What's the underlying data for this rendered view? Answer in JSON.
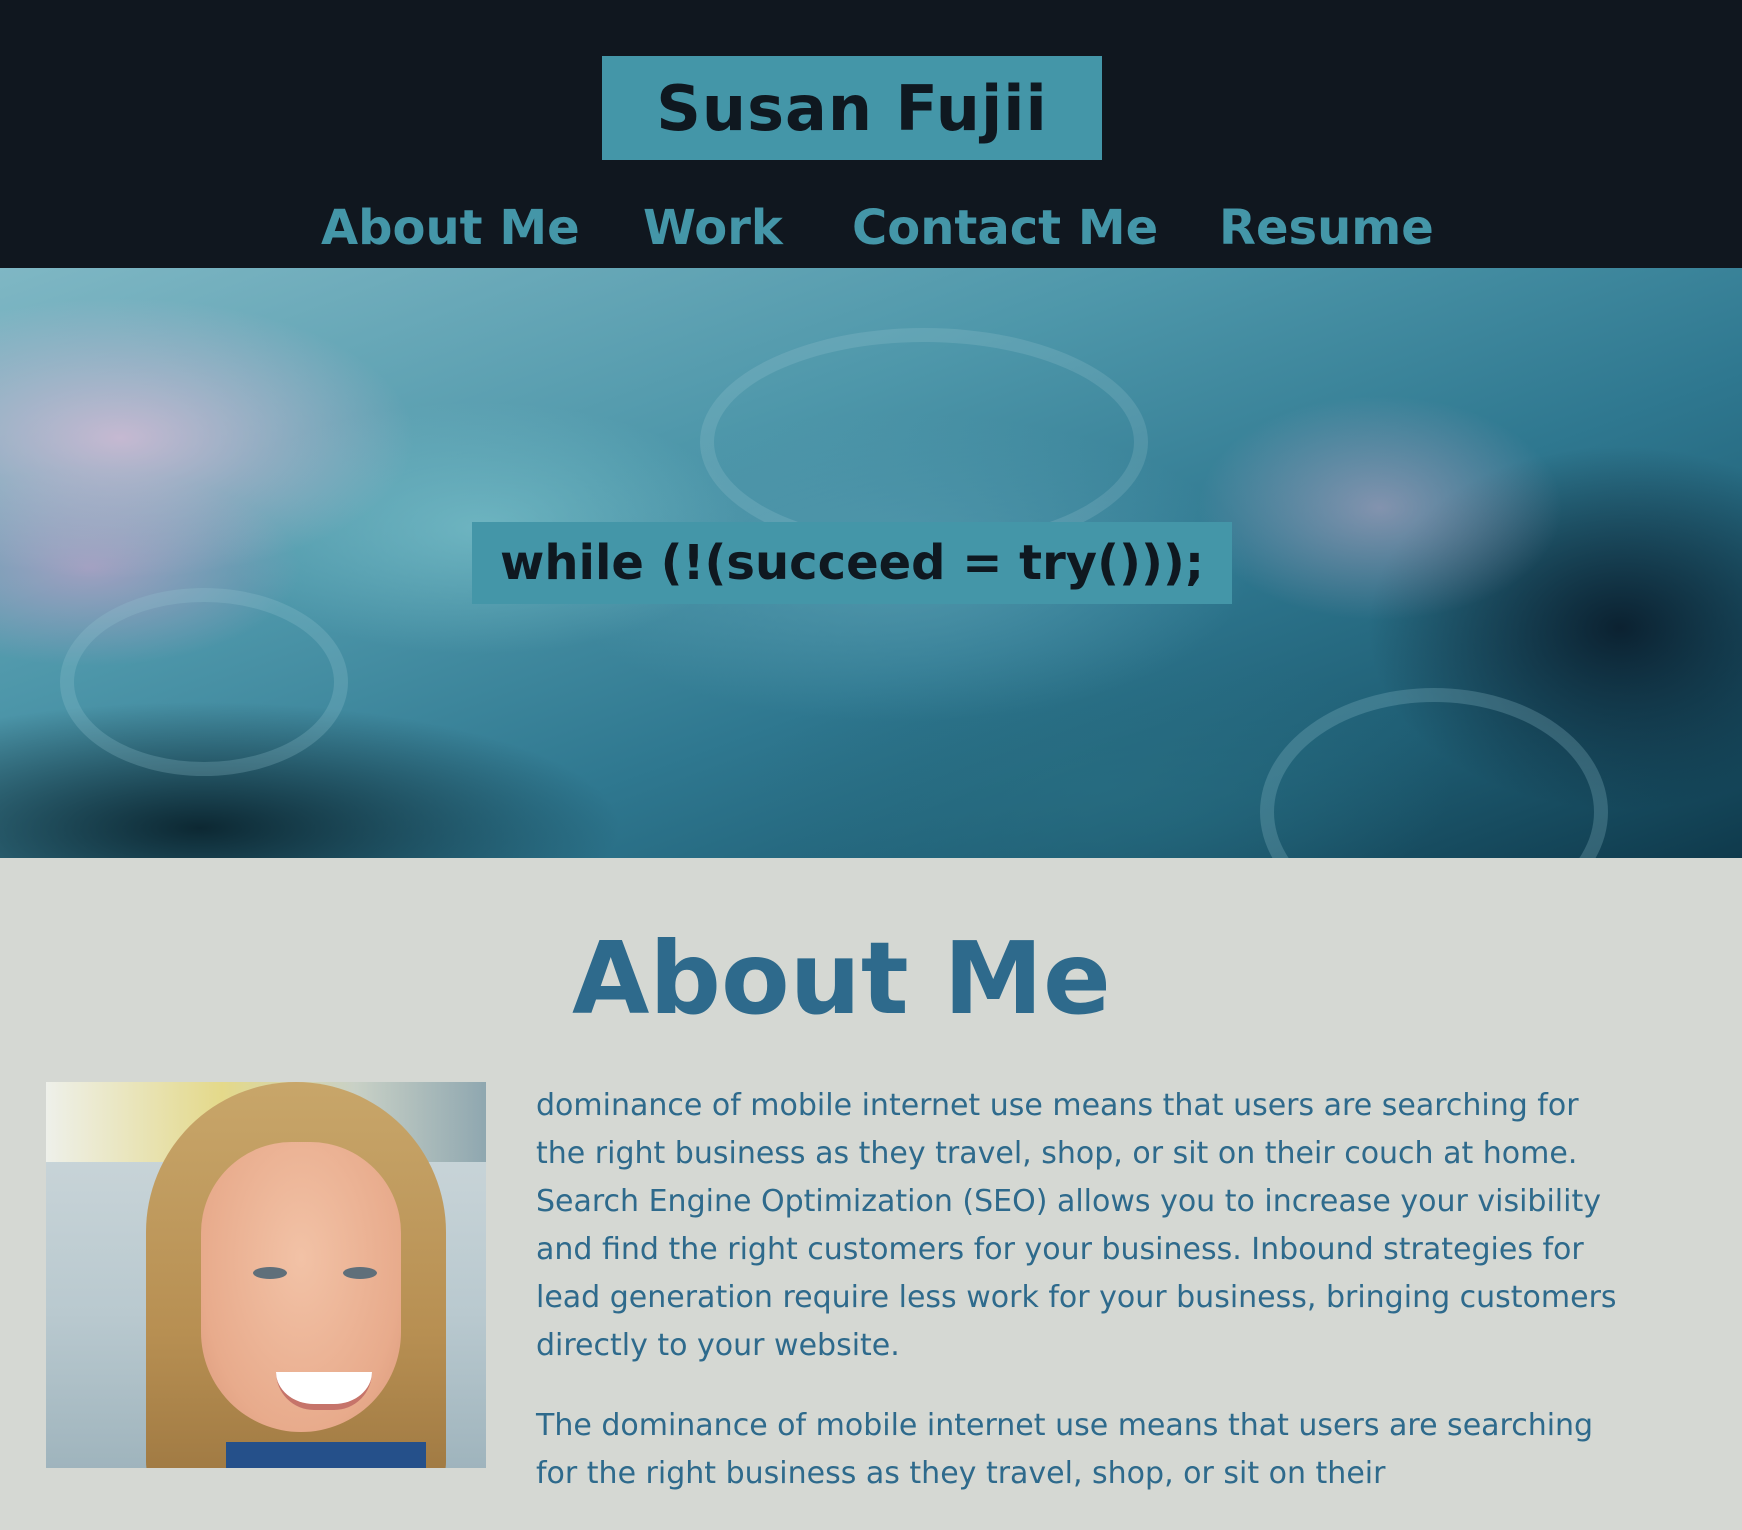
{
  "header": {
    "site_name": "Susan Fujii",
    "colors": {
      "background": "#10171f",
      "accent": "#4496a8"
    }
  },
  "nav": {
    "items": [
      {
        "label": "About Me"
      },
      {
        "label": "Work"
      },
      {
        "label": "Contact Me"
      },
      {
        "label": "Resume"
      }
    ]
  },
  "hero": {
    "tagline": "while (!(succeed = try()));"
  },
  "about": {
    "title": "About Me",
    "photo_icon": "portrait-photo",
    "paragraphs": [
      "dominance of mobile internet use means that users are searching for the right business as they travel, shop, or sit on their couch at home. Search Engine Optimization (SEO) allows you to increase your visibility and find the right customers for your business. Inbound strategies for lead generation require less work for your business, bringing customers directly to your website.",
      "The dominance of mobile internet use means that users are searching for the right business as they travel, shop, or sit on their"
    ],
    "colors": {
      "background": "#d5d8d3",
      "text": "#2e6a8c"
    }
  }
}
